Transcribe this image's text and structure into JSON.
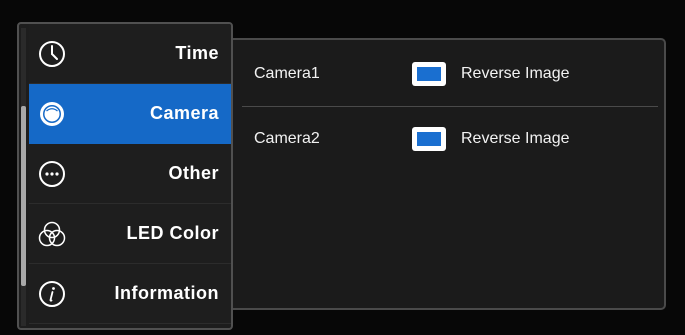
{
  "sidebar": {
    "items": [
      {
        "label": "Time",
        "icon": "clock-icon",
        "selected": false
      },
      {
        "label": "Camera",
        "icon": "camera-icon",
        "selected": true
      },
      {
        "label": "Other",
        "icon": "more-icon",
        "selected": false
      },
      {
        "label": "LED Color",
        "icon": "color-circles-icon",
        "selected": false
      },
      {
        "label": "Information",
        "icon": "info-icon",
        "selected": false
      }
    ]
  },
  "camera_settings": {
    "rows": [
      {
        "camera": "Camera1",
        "option": "Reverse Image",
        "checked": true
      },
      {
        "camera": "Camera2",
        "option": "Reverse Image",
        "checked": true
      }
    ]
  },
  "colors": {
    "accent": "#1569c7",
    "checkbox_fill": "#1a6fd0"
  }
}
